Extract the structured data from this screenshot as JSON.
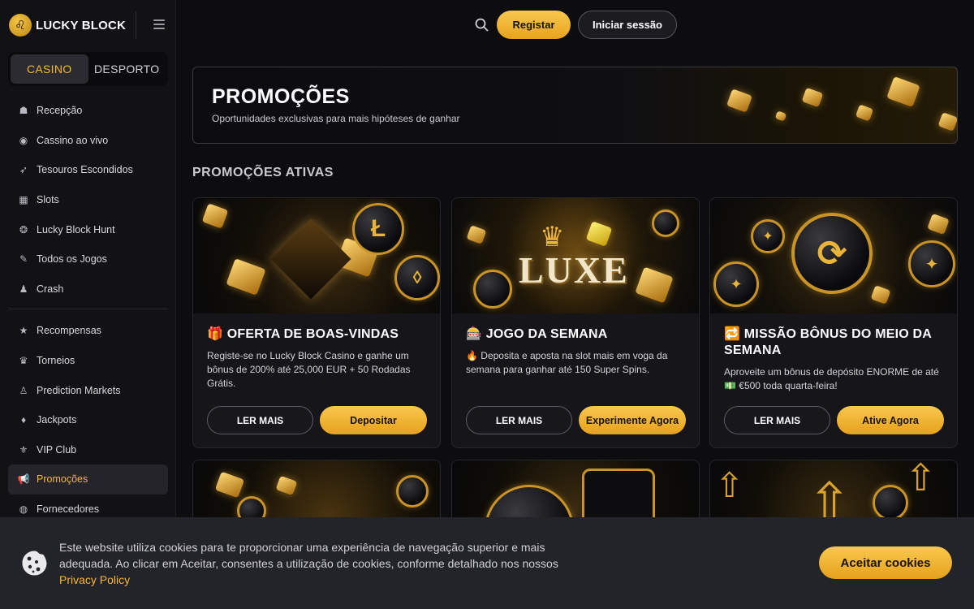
{
  "brand": {
    "name": "LUCKY BLOCK"
  },
  "switcher": {
    "casino": "CASINO",
    "sport": "DESPORTO"
  },
  "nav": {
    "main": [
      {
        "label": "Recepção",
        "icon": "home-icon"
      },
      {
        "label": "Cassino ao vivo",
        "icon": "live-icon"
      },
      {
        "label": "Tesouros Escondidos",
        "icon": "rocket-icon"
      },
      {
        "label": "Slots",
        "icon": "slot-icon"
      },
      {
        "label": "Lucky Block Hunt",
        "icon": "hunt-icon"
      },
      {
        "label": "Todos os Jogos",
        "icon": "games-icon"
      },
      {
        "label": "Crash",
        "icon": "crash-icon"
      }
    ],
    "secondary": [
      {
        "label": "Recompensas",
        "icon": "star-icon"
      },
      {
        "label": "Torneios",
        "icon": "trophy-icon"
      },
      {
        "label": "Prediction Markets",
        "icon": "prediction-icon"
      },
      {
        "label": "Jackpots",
        "icon": "diamond-icon"
      },
      {
        "label": "VIP Club",
        "icon": "vip-icon"
      },
      {
        "label": "Promoções",
        "icon": "megaphone-icon"
      },
      {
        "label": "Fornecedores",
        "icon": "globe-icon"
      }
    ]
  },
  "header": {
    "register": "Registar",
    "login": "Iniciar sessão"
  },
  "hero": {
    "title": "PROMOÇÕES",
    "subtitle": "Oportunidades exclusivas para mais hipóteses de ganhar"
  },
  "section": {
    "active_title": "PROMOÇÕES ATIVAS"
  },
  "cards": [
    {
      "emoji": "🎁",
      "title": "OFERTA DE BOAS-VINDAS",
      "desc": "Registe-se no Lucky Block Casino e ganhe um bônus de 200% até 25,000 EUR + 50 Rodadas Grátis.",
      "more": "LER MAIS",
      "cta": "Depositar"
    },
    {
      "emoji": "🎰",
      "title": "JOGO DA SEMANA",
      "desc": "🔥 Deposita e aposta na slot mais em voga da semana para ganhar até 150 Super Spins.",
      "more": "LER MAIS",
      "cta": "Experimente Agora",
      "image_text": "LUXE"
    },
    {
      "emoji": "🔁",
      "title": "MISSÃO BÔNUS DO MEIO DA SEMANA",
      "desc": "Aproveite um bônus de depósito ENORME de até 💵 €500 toda quarta-feira!",
      "more": "LER MAIS",
      "cta": "Ative Agora"
    }
  ],
  "cookie": {
    "text": "Este website utiliza cookies para te proporcionar uma experiência de navegação superior e mais adequada. Ao clicar em Aceitar, consentes a utilização de cookies, conforme detalhado nos nossos ",
    "link": "Privacy Policy",
    "accept": "Aceitar cookies"
  },
  "colors": {
    "accent": "#f4b73a",
    "background": "#0d0d10",
    "sidebar": "#121216"
  }
}
